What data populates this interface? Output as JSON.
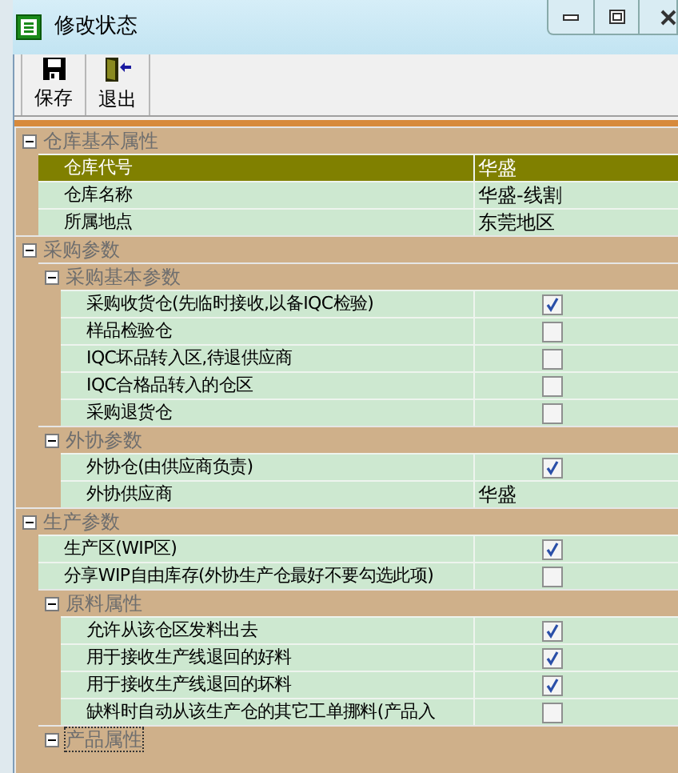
{
  "window": {
    "title": "修改状态"
  },
  "toolbar": [
    {
      "kind": "save",
      "label": "保存"
    },
    {
      "kind": "exit",
      "label": "退出"
    }
  ],
  "groups": [
    {
      "kind": "category",
      "label": "仓库基本属性",
      "expanded": true,
      "focused": false,
      "children": [
        {
          "kind": "text",
          "label": "仓库代号",
          "value": "华盛",
          "selected": true
        },
        {
          "kind": "text",
          "label": "仓库名称",
          "value": "华盛-线割",
          "selected": false
        },
        {
          "kind": "text",
          "label": "所属地点",
          "value": "东莞地区",
          "selected": false
        }
      ]
    },
    {
      "kind": "category",
      "label": "采购参数",
      "expanded": true,
      "focused": false,
      "children": [
        {
          "kind": "category",
          "label": "采购基本参数",
          "expanded": true,
          "focused": false,
          "children": [
            {
              "kind": "check",
              "label": "采购收货仓(先临时接收,以备IQC检验)",
              "checked": true,
              "selected": false
            },
            {
              "kind": "check",
              "label": "样品检验仓",
              "checked": false,
              "selected": false
            },
            {
              "kind": "check",
              "label": "IQC坏品转入区,待退供应商",
              "checked": false,
              "selected": false
            },
            {
              "kind": "check",
              "label": "IQC合格品转入的仓区",
              "checked": false,
              "selected": false
            },
            {
              "kind": "check",
              "label": "采购退货仓",
              "checked": false,
              "selected": false
            }
          ]
        },
        {
          "kind": "category",
          "label": "外协参数",
          "expanded": true,
          "focused": false,
          "children": [
            {
              "kind": "check",
              "label": "外协仓(由供应商负责)",
              "checked": true,
              "selected": false
            },
            {
              "kind": "text",
              "label": "外协供应商",
              "value": "华盛",
              "selected": false
            }
          ]
        }
      ]
    },
    {
      "kind": "category",
      "label": "生产参数",
      "expanded": true,
      "focused": false,
      "children": [
        {
          "kind": "check",
          "label": "生产区(WIP区)",
          "checked": true,
          "selected": false
        },
        {
          "kind": "check",
          "label": "分享WIP自由库存(外协生产仓最好不要勾选此项)",
          "checked": false,
          "selected": false
        },
        {
          "kind": "category",
          "label": "原料属性",
          "expanded": true,
          "focused": false,
          "children": [
            {
              "kind": "check",
              "label": "允许从该仓区发料出去",
              "checked": true,
              "selected": false
            },
            {
              "kind": "check",
              "label": "用于接收生产线退回的好料",
              "checked": true,
              "selected": false
            },
            {
              "kind": "check",
              "label": "用于接收生产线退回的坏料",
              "checked": true,
              "selected": false
            },
            {
              "kind": "check",
              "label": "缺料时自动从该生产仓的其它工单挪料(产品入",
              "checked": false,
              "selected": false
            }
          ]
        },
        {
          "kind": "category",
          "label": "产品属性",
          "expanded": true,
          "focused": true
        }
      ]
    }
  ]
}
